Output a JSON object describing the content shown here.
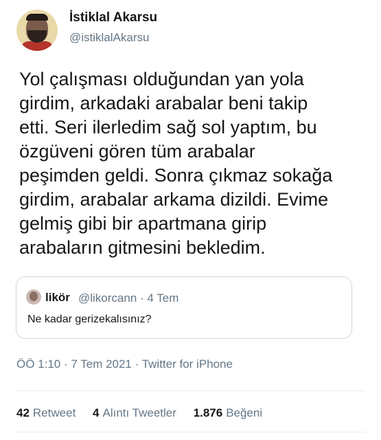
{
  "author": {
    "name": "İstiklal Akarsu",
    "handle": "@istiklalAkarsu"
  },
  "tweet": {
    "lines": [
      "Yol çalışması olduğundan yan yola",
      "girdim, arkadaki arabalar beni takip",
      "etti. Seri ilerledim sağ sol yaptım, bu",
      "özgüveni gören tüm arabalar",
      "peşimden geldi. Sonra çıkmaz sokağa",
      "girdim, arabalar arkama dizildi. Evime",
      "gelmiş gibi bir apartmana girip",
      "arabaların gitmesini bekledim."
    ]
  },
  "quote": {
    "name": "likör",
    "handle_date": "@likorcann · 4 Tem",
    "text": "Ne kadar gerizekalısınız?"
  },
  "meta": "ÖÖ 1:10 · 7 Tem 2021 · Twitter for iPhone",
  "stats": {
    "retweets_count": "42",
    "retweets_label": "Retweet",
    "quotes_count": "4",
    "quotes_label": "Alıntı Tweetler",
    "likes_count": "1.876",
    "likes_label": "Beğeni"
  }
}
